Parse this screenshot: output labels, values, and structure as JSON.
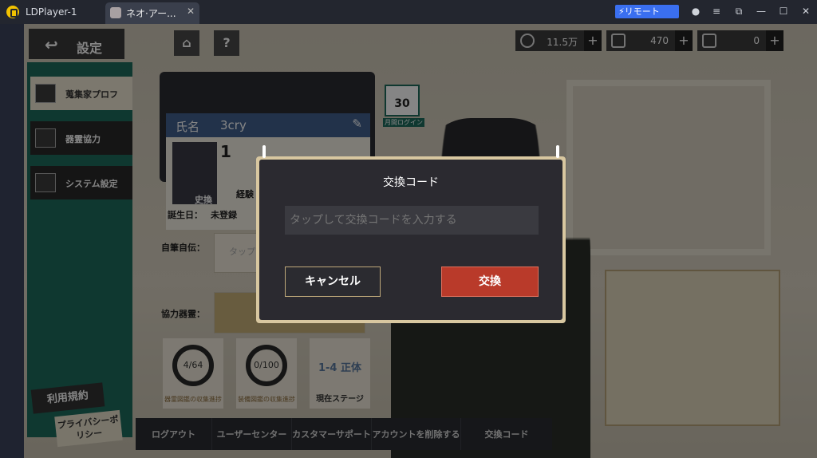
{
  "window": {
    "app_title": "LDPlayer-1",
    "tab_label": "ネオ·アー...",
    "tab_close": "✕",
    "remote_label": "リモート"
  },
  "header": {
    "back_label": "設定",
    "home_icon": "home-icon",
    "help_label": "?"
  },
  "resources": [
    {
      "value": "11.5万",
      "plus": "+"
    },
    {
      "value": "470",
      "plus": "+"
    },
    {
      "value": "0",
      "plus": "+"
    }
  ],
  "sidebar": {
    "items": [
      {
        "label": "蒐集家プロフ"
      },
      {
        "label": "器霊協力"
      },
      {
        "label": "システム設定"
      }
    ],
    "terms": "利用規約",
    "privacy": "プライバシーポリシー"
  },
  "profile": {
    "name_label": "氏名",
    "name_value": "3cry",
    "level": "1",
    "experience_label": "経験",
    "badge": "史換",
    "birthday_label": "誕生日：",
    "birthday_value": "未登録",
    "bio_label": "自筆自伝：",
    "bio_placeholder": "タップ",
    "spirit_label": "協力器霊："
  },
  "calendar": {
    "day": "30",
    "label": "月間ログイン"
  },
  "stats": [
    {
      "value": "4/64",
      "label": "器霊図鑑の収集進捗"
    },
    {
      "value": "0/100",
      "label": "装備図鑑の収集進捗"
    },
    {
      "value": "1-4 正体",
      "label": "現在ステージ"
    }
  ],
  "bottom_bar": [
    "ログアウト",
    "ユーザーセンター",
    "カスタマーサポート",
    "アカウントを削除する",
    "交換コード"
  ],
  "modal": {
    "title": "交換コード",
    "input_placeholder": "タップして交換コードを入力する",
    "cancel_label": "キャンセル",
    "confirm_label": "交換"
  }
}
